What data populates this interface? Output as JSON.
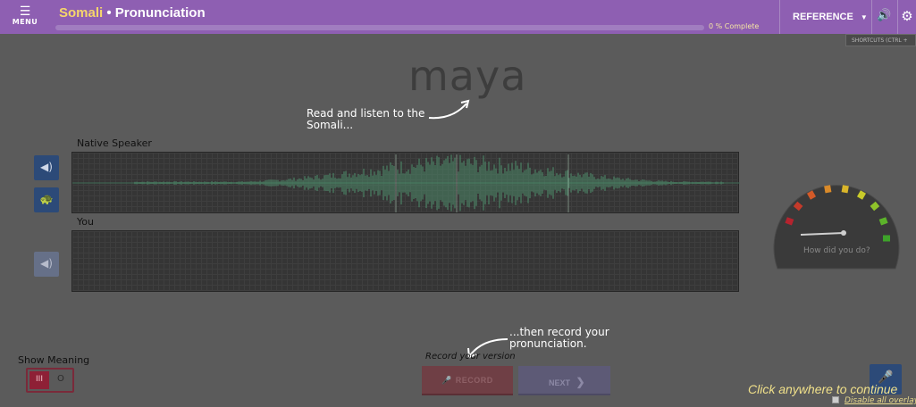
{
  "header": {
    "menu_icon": "☰",
    "menu_label": "MENU",
    "language": "Somali",
    "separator": " • ",
    "section": "Pronunciation",
    "progress_percent": 0,
    "progress_text": "0 % Complete",
    "reference_label": "REFERENCE",
    "reference_caret": "▼",
    "speaker_icon": "🔊",
    "gear_icon": "⚙",
    "shortcuts_label": "SHORTCUTS (CTRL +"
  },
  "lesson": {
    "word": "maya",
    "hint_read": "Read and listen to the Somali...",
    "hint_record": "...then record your pronunciation."
  },
  "panels": {
    "native_label": "Native Speaker",
    "you_label": "You",
    "play_icon": "◀)",
    "turtle_icon": "🐢",
    "play_you_icon": "◀)"
  },
  "gauge": {
    "text": "How did you do?",
    "colors": [
      "#b5232e",
      "#c53a2a",
      "#d45a28",
      "#d98a2a",
      "#d9b52a",
      "#c9cb2a",
      "#8fc32a",
      "#5cb32a",
      "#3ea32a"
    ]
  },
  "footer": {
    "show_meaning": "Show Meaning",
    "toggle_on": "III",
    "toggle_off": "O",
    "record_version": "Record your version",
    "record_label": "RECORD",
    "record_icon": "🎤",
    "next_label": "NEXT",
    "next_icon": "❯",
    "mic_icon": "🎤",
    "click_continue": "Click anywhere to continue",
    "disable_overlay": "Disable all overlay"
  }
}
